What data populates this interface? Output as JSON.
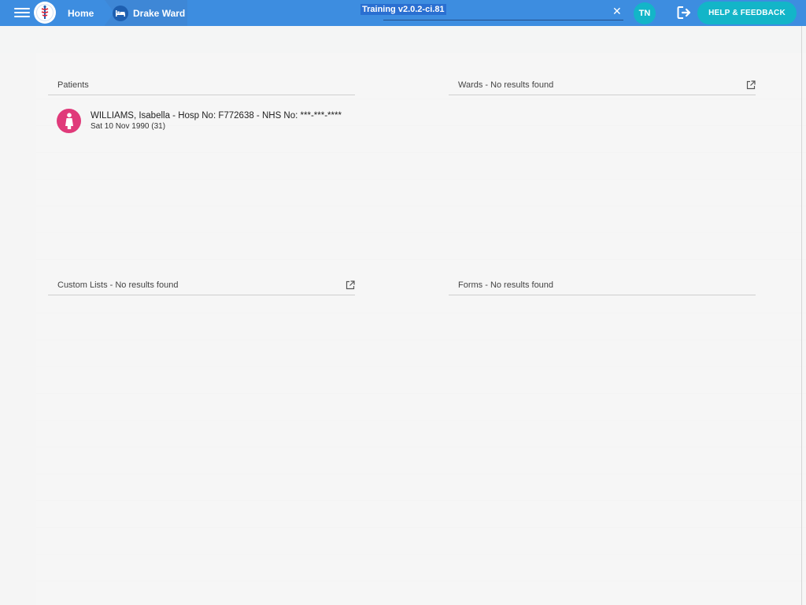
{
  "topbar": {
    "home_label": "Home",
    "ward_label": "Drake Ward",
    "search_value": "Training v2.0.2-ci.81",
    "user_initials": "TN",
    "help_label": "HELP & FEEDBACK",
    "colors": {
      "bar": "#3d8de0",
      "accent": "#13b5c8"
    }
  },
  "results": {
    "patients": {
      "title": "Patients",
      "items": [
        {
          "name_line": "WILLIAMS, Isabella - Hosp No: F772638 - NHS No: ***-***-****",
          "dob_line": "Sat 10 Nov 1990 (31)",
          "icon": "female-person-icon",
          "icon_color": "#e03a7a"
        }
      ]
    },
    "wards": {
      "title": "Wards - No results found"
    },
    "custom_lists": {
      "title": "Custom Lists - No results found"
    },
    "forms": {
      "title": "Forms - No results found"
    }
  }
}
